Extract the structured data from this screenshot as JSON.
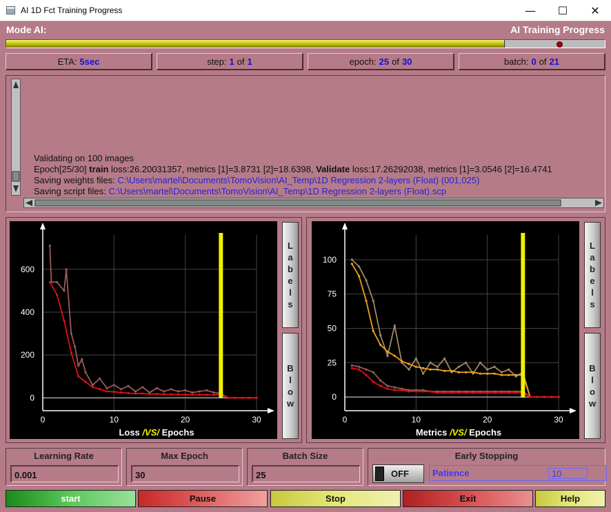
{
  "window": {
    "title": "AI 1D Fct Training Progress",
    "minimize_glyph": "—",
    "maximize_glyph": "☐",
    "close_glyph": "✕"
  },
  "header": {
    "mode_label": "Mode AI:",
    "progress_title": "AI Training Progress"
  },
  "progress": {
    "fraction": 0.833,
    "colors": {
      "fill": "#c8c800",
      "marker": "#a00010"
    }
  },
  "stats": {
    "eta": {
      "label": "ETA:",
      "value": "5sec"
    },
    "step": {
      "label": "step:",
      "current": "1",
      "of": "of",
      "total": "1"
    },
    "epoch": {
      "label": "epoch:",
      "current": "25",
      "of": "of",
      "total": "30"
    },
    "batch": {
      "label": "batch:",
      "current": "0",
      "of": "of",
      "total": "21"
    }
  },
  "log": {
    "line1": "Validating on 100 images",
    "line2": {
      "prefix": "Epoch[25/30] ",
      "train_word": "train",
      "train_rest": " loss:26.20031357, metrics [1]=3.8731 [2]=18.6398, ",
      "validate_word": "Validate",
      "validate_rest": " loss:17.26292038, metrics [1]=3.0546 [2]=16.4741"
    },
    "line3": {
      "label": "Saving weights files: ",
      "path": "C:\\Users\\martel\\Documents\\TomoVision\\AI_Temp\\1D Regression 2-layers (Float) (001,025)"
    },
    "line4": {
      "label": "Saving script files: ",
      "path": "C:\\Users\\martel\\Documents\\TomoVision\\AI_Temp\\1D Regression 2-layers (Float).scp"
    }
  },
  "chart_data": [
    {
      "type": "line",
      "title_parts": [
        "Loss ",
        "/VS/",
        " Epochs"
      ],
      "xlim": [
        0,
        30
      ],
      "ylim": [
        -60,
        760
      ],
      "xticks": [
        0,
        10,
        20,
        30
      ],
      "yticks": [
        0,
        200,
        400,
        600
      ],
      "current_epoch": 25,
      "grid": true,
      "series": [
        {
          "color": "#9a5a5a",
          "x": [
            1,
            1.2,
            2,
            3,
            3.3,
            4,
            4.5,
            5,
            5.5,
            6,
            7,
            8,
            9,
            10,
            11,
            12,
            13,
            14,
            15,
            16,
            17,
            18,
            19,
            20,
            21,
            22,
            23,
            24,
            25,
            26,
            27,
            28,
            29,
            30
          ],
          "values": [
            710,
            540,
            540,
            500,
            600,
            300,
            240,
            150,
            180,
            120,
            60,
            90,
            45,
            60,
            40,
            55,
            30,
            50,
            25,
            45,
            30,
            40,
            30,
            35,
            25,
            30,
            35,
            25,
            20,
            0,
            0,
            0,
            0,
            0
          ]
        },
        {
          "color": "#e01010",
          "x": [
            1,
            2,
            3,
            4,
            5,
            6,
            7,
            8,
            9,
            10,
            11,
            12,
            13,
            14,
            15,
            16,
            17,
            18,
            19,
            20,
            21,
            22,
            23,
            24,
            25,
            26,
            27,
            28,
            29,
            30
          ],
          "values": [
            540,
            480,
            360,
            210,
            100,
            75,
            50,
            40,
            30,
            28,
            25,
            22,
            20,
            20,
            18,
            18,
            17,
            16,
            16,
            15,
            15,
            15,
            14,
            14,
            15,
            0,
            0,
            0,
            0,
            0
          ]
        }
      ]
    },
    {
      "type": "line",
      "title_parts": [
        "Metrics ",
        "/VS/",
        " Epochs"
      ],
      "xlim": [
        0,
        30
      ],
      "ylim": [
        -10,
        118
      ],
      "xticks": [
        0,
        10,
        20,
        30
      ],
      "yticks": [
        0,
        25,
        50,
        75,
        100
      ],
      "current_epoch": 25,
      "grid": true,
      "series": [
        {
          "color": "#a08a60",
          "x": [
            1,
            2,
            3,
            4,
            5,
            6,
            7,
            8,
            9,
            10,
            11,
            12,
            13,
            14,
            15,
            16,
            17,
            18,
            19,
            20,
            21,
            22,
            23,
            24,
            25,
            26,
            27,
            28,
            29,
            30
          ],
          "values": [
            100,
            95,
            85,
            70,
            45,
            30,
            52,
            25,
            20,
            28,
            17,
            25,
            22,
            28,
            18,
            22,
            25,
            17,
            25,
            20,
            22,
            18,
            20,
            15,
            18,
            0,
            0,
            0,
            0,
            0
          ]
        },
        {
          "color": "#f0a020",
          "x": [
            1,
            2,
            3,
            4,
            5,
            6,
            7,
            8,
            9,
            10,
            11,
            12,
            13,
            14,
            15,
            16,
            17,
            18,
            19,
            20,
            21,
            22,
            23,
            24,
            25,
            26,
            27,
            28,
            29,
            30
          ],
          "values": [
            97,
            88,
            70,
            48,
            38,
            33,
            30,
            26,
            24,
            22,
            21,
            20,
            20,
            19,
            19,
            18,
            18,
            18,
            17,
            17,
            17,
            16,
            16,
            16,
            16,
            0,
            0,
            0,
            0,
            0
          ]
        },
        {
          "color": "#9a5a5a",
          "x": [
            1,
            2,
            3,
            4,
            5,
            6,
            7,
            8,
            9,
            10,
            11,
            12,
            13,
            14,
            15,
            16,
            17,
            18,
            19,
            20,
            21,
            22,
            23,
            24,
            25,
            26,
            27,
            28,
            29,
            30
          ],
          "values": [
            23,
            22,
            20,
            18,
            12,
            8,
            7,
            6,
            5,
            5,
            5,
            4,
            4,
            4,
            4,
            4,
            4,
            4,
            4,
            4,
            4,
            4,
            4,
            4,
            4,
            0,
            0,
            0,
            0,
            0
          ]
        },
        {
          "color": "#e01010",
          "x": [
            1,
            2,
            3,
            4,
            5,
            6,
            7,
            8,
            9,
            10,
            11,
            12,
            13,
            14,
            15,
            16,
            17,
            18,
            19,
            20,
            21,
            22,
            23,
            24,
            25,
            26,
            27,
            28,
            29,
            30
          ],
          "values": [
            21,
            20,
            16,
            11,
            8,
            6,
            5,
            5,
            4,
            4,
            4,
            4,
            3,
            3,
            3,
            3,
            3,
            3,
            3,
            3,
            3,
            3,
            3,
            3,
            3,
            0,
            0,
            0,
            0,
            0
          ]
        }
      ]
    }
  ],
  "side_buttons": {
    "labels": "Labels",
    "blow": "Blow"
  },
  "params": {
    "learning_rate": {
      "label": "Learning Rate",
      "value": "0.001"
    },
    "max_epoch": {
      "label": "Max Epoch",
      "value": "30"
    },
    "batch_size": {
      "label": "Batch Size",
      "value": "25"
    },
    "early_stopping": {
      "label": "Early Stopping",
      "toggle": "OFF",
      "patience_label": "Patience",
      "patience_value": "10"
    }
  },
  "actions": {
    "start": "start",
    "pause": "Pause",
    "stop": "Stop",
    "exit": "Exit",
    "help": "Help"
  },
  "colors": {
    "background": "#b57b88",
    "value_blue": "#1010e0",
    "epoch_marker": "#f0f000"
  }
}
